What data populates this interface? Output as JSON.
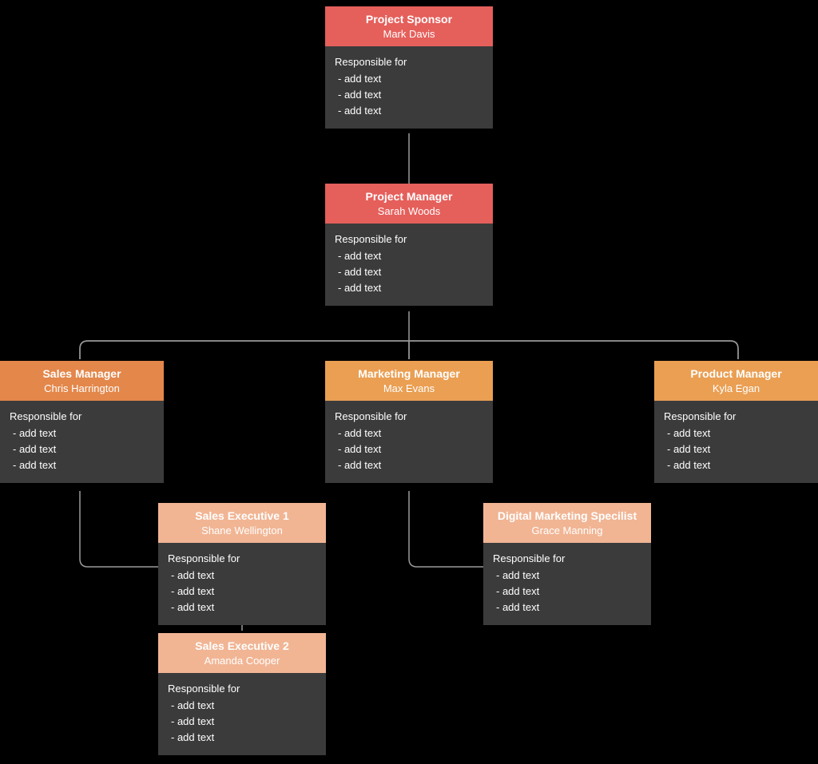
{
  "common": {
    "resp_header": "Responsible for",
    "resp_line": "- add text"
  },
  "nodes": {
    "sponsor": {
      "title": "Project Sponsor",
      "name": "Mark Davis"
    },
    "pm": {
      "title": "Project Manager",
      "name": "Sarah Woods"
    },
    "sales_mgr": {
      "title": "Sales Manager",
      "name": "Chris Harrington"
    },
    "mkt_mgr": {
      "title": "Marketing Manager",
      "name": "Max Evans"
    },
    "prod_mgr": {
      "title": "Product Manager",
      "name": "Kyla Egan"
    },
    "se1": {
      "title": "Sales Executive 1",
      "name": "Shane Wellington"
    },
    "se2": {
      "title": "Sales Executive 2",
      "name": "Amanda Cooper"
    },
    "dms": {
      "title": "Digital Marketing Specilist",
      "name": "Grace Manning"
    }
  }
}
